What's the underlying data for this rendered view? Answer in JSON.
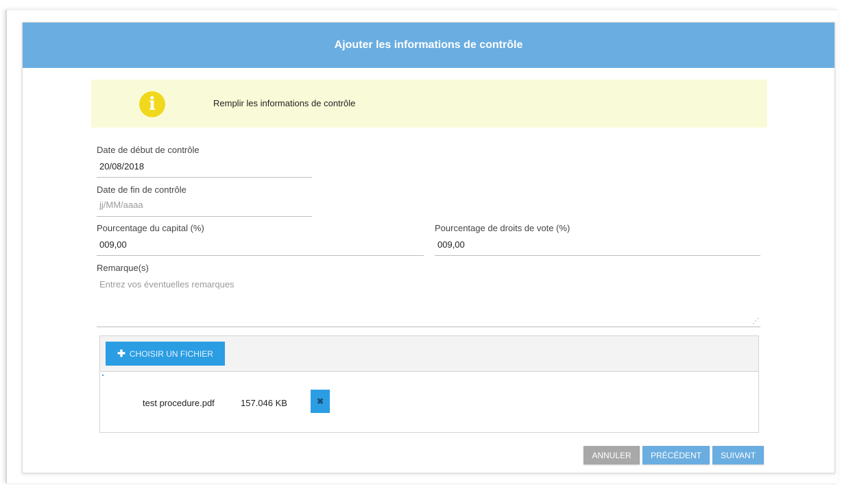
{
  "dialog": {
    "title": "Ajouter les informations de contrôle"
  },
  "info": {
    "icon": "info-icon",
    "icon_glyph": "i",
    "message": "Remplir les informations de contrôle"
  },
  "form": {
    "start_date": {
      "label": "Date de début de contrôle",
      "value": "20/08/2018"
    },
    "end_date": {
      "label": "Date de fin de contrôle",
      "placeholder": "jj/MM/aaaa"
    },
    "capital_pct": {
      "label": "Pourcentage du capital (%)",
      "value": "009,00"
    },
    "voting_pct": {
      "label": "Pourcentage de droits de vote (%)",
      "value": "009,00"
    },
    "remarks": {
      "label": "Remarque(s)",
      "placeholder": "Entrez vos éventuelles remarques"
    }
  },
  "upload": {
    "choose_label": "CHOISIR UN FICHIER",
    "files": [
      {
        "name": "test procedure.pdf",
        "size": "157.046 KB"
      }
    ],
    "remove_glyph": "✖"
  },
  "actions": {
    "cancel": "ANNULER",
    "previous": "PRÉCÉDENT",
    "next": "SUIVANT"
  },
  "colors": {
    "header": "#6aade0",
    "primary_button": "#2b9de3",
    "banner_bg": "#f9fbd8",
    "info_icon": "#f0d81c",
    "cancel_button": "#a8a8a8"
  }
}
